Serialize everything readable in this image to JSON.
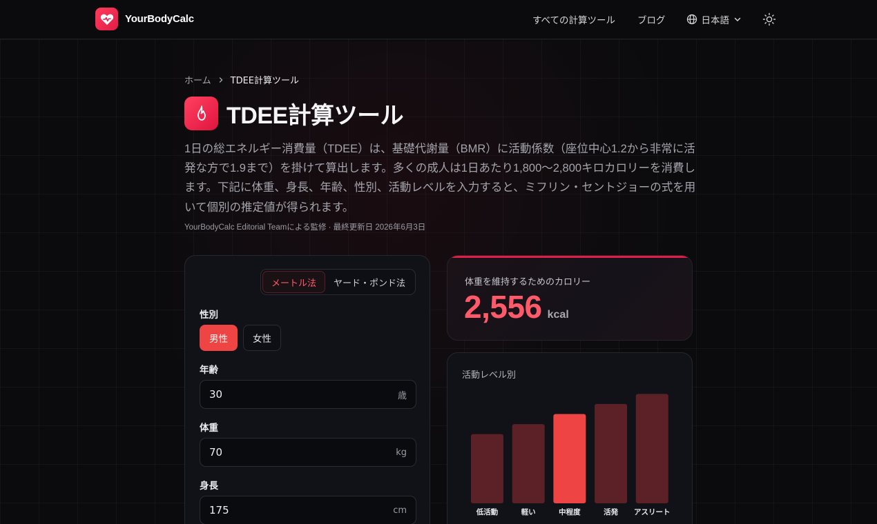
{
  "header": {
    "brand": "YourBodyCalc",
    "nav": {
      "all_tools": "すべての計算ツール",
      "blog": "ブログ",
      "language": "日本語"
    }
  },
  "breadcrumb": {
    "home": "ホーム",
    "current": "TDEE計算ツール"
  },
  "page": {
    "title": "TDEE計算ツール",
    "description": "1日の総エネルギー消費量（TDEE）は、基礎代謝量（BMR）に活動係数（座位中心1.2から非常に活発な方で1.9まで）を掛けて算出します。多くの成人は1日あたり1,800〜2,800キロカロリーを消費します。下記に体重、身長、年齢、性別、活動レベルを入力すると、ミフリン・セントジョーの式を用いて個別の推定値が得られます。",
    "meta": "YourBodyCalc Editorial Teamによる監修 · 最終更新日 2026年6月3日"
  },
  "form": {
    "units": [
      "メートル法",
      "ヤード・ポンド法"
    ],
    "selected_unit": "メートル法",
    "gender_label": "性別",
    "gender_options": [
      "男性",
      "女性"
    ],
    "selected_gender": "男性",
    "age": {
      "label": "年齢",
      "value": "30",
      "unit": "歳"
    },
    "weight": {
      "label": "体重",
      "value": "70",
      "unit": "kg"
    },
    "height": {
      "label": "身長",
      "value": "175",
      "unit": "cm"
    }
  },
  "result": {
    "label": "体重を維持するためのカロリー",
    "value": "2,556",
    "unit": "kcal"
  },
  "colors": {
    "accent": "#ef4444",
    "bar_inactive": "#5c2126",
    "bar_active": "#ef4444"
  },
  "chart_data": {
    "type": "bar",
    "title": "活動レベル別",
    "categories": [
      "低活動",
      "軽い",
      "中程度",
      "活発",
      "アスリート"
    ],
    "values": [
      2029,
      2324,
      2619,
      2914,
      3209
    ],
    "active_index": 2,
    "ylim": [
      0,
      3600
    ],
    "grid": false,
    "xlabel": "",
    "ylabel": ""
  }
}
